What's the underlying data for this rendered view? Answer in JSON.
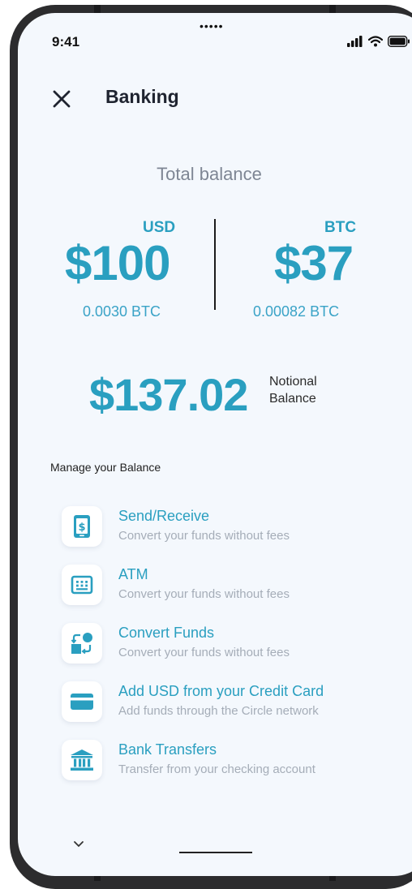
{
  "status": {
    "time": "9:41",
    "notch": "•••••"
  },
  "header": {
    "title": "Banking"
  },
  "balance": {
    "total_label": "Total balance",
    "usd": {
      "label": "USD",
      "amount": "$100",
      "btc_equiv": "0.0030 BTC"
    },
    "btc": {
      "label": "BTC",
      "amount": "$37",
      "btc_equiv": "0.00082 BTC"
    },
    "notional": {
      "amount": "$137.02",
      "label_line1": "Notional",
      "label_line2": "Balance"
    }
  },
  "manage": {
    "title": "Manage your Balance",
    "items": [
      {
        "icon": "phone-dollar-icon",
        "title": "Send/Receive",
        "subtitle": "Convert your funds without fees"
      },
      {
        "icon": "atm-keypad-icon",
        "title": "ATM",
        "subtitle": "Convert your funds without fees"
      },
      {
        "icon": "convert-icon",
        "title": "Convert Funds",
        "subtitle": "Convert your funds without fees"
      },
      {
        "icon": "credit-card-icon",
        "title": "Add USD from your Credit Card",
        "subtitle": "Add funds through the Circle network"
      },
      {
        "icon": "bank-icon",
        "title": "Bank Transfers",
        "subtitle": "Transfer from your checking account"
      }
    ]
  },
  "colors": {
    "accent": "#2a9fc0",
    "background": "#f4f8fd",
    "muted": "#a5adb8"
  }
}
